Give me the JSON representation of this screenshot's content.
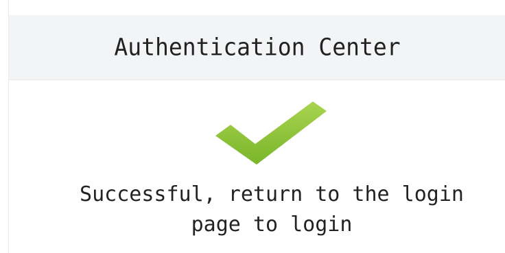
{
  "header": {
    "title": "Authentication Center"
  },
  "status": {
    "icon": "check-icon",
    "icon_color": "#8cc63f",
    "message_line1": "Successful, return to the login",
    "message_line2": "page to login"
  }
}
